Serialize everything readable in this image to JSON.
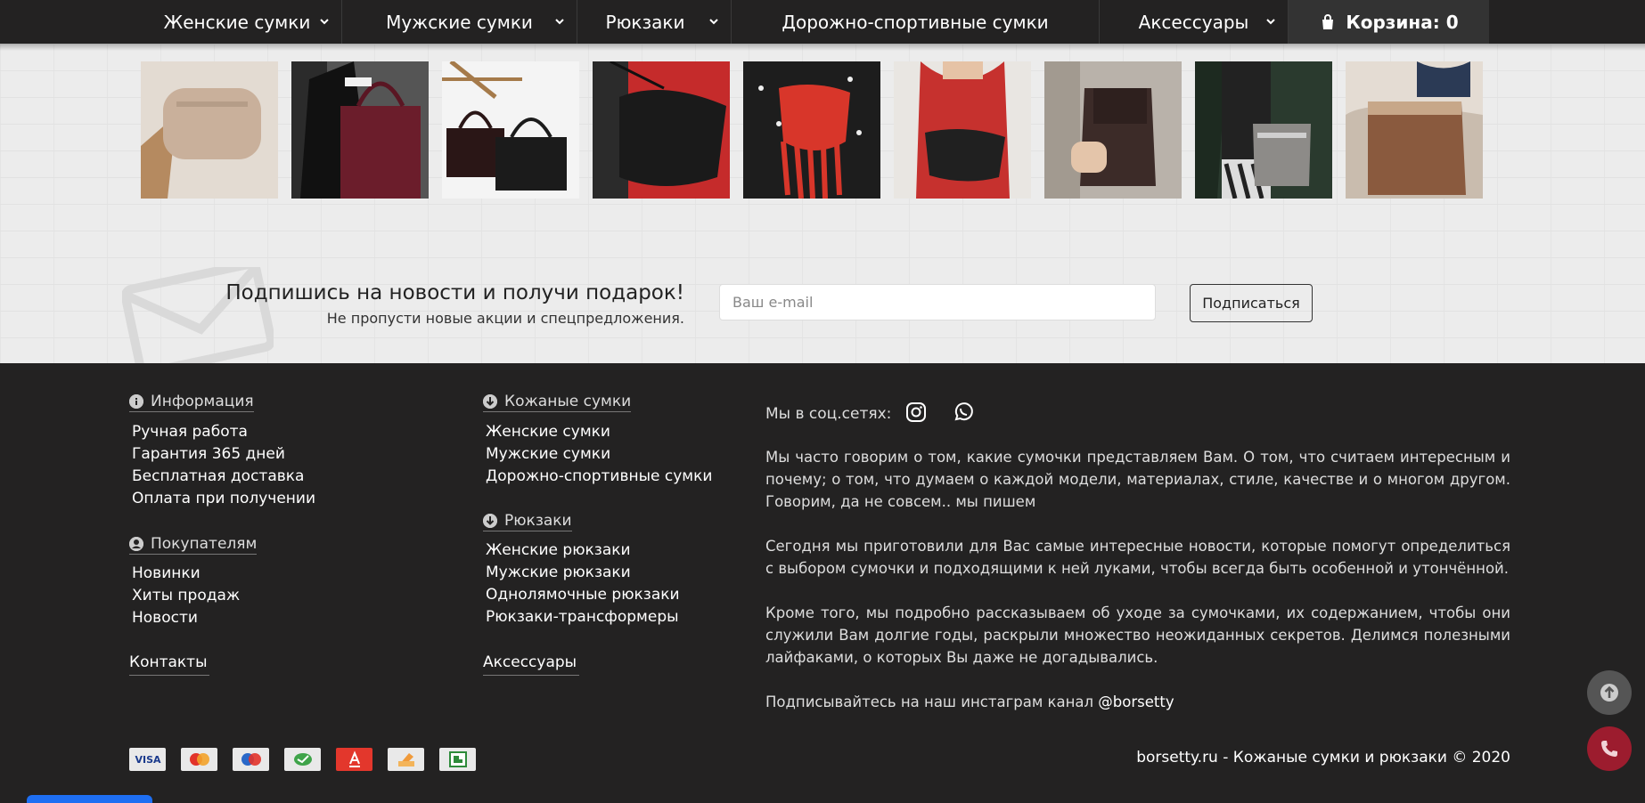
{
  "nav": {
    "items": [
      {
        "label": "Женские сумки",
        "width": 209,
        "dropdown": true
      },
      {
        "label": "Мужские сумки",
        "width": 264,
        "dropdown": true
      },
      {
        "label": "Рюкзаки",
        "width": 173,
        "dropdown": true
      },
      {
        "label": "Дорожно-спортивные сумки",
        "width": 413,
        "dropdown": false
      },
      {
        "label": "Аксессуары",
        "width": 212,
        "dropdown": true
      }
    ],
    "cart_label": "Корзина: 0"
  },
  "thumbs": [
    {
      "bg": "#e9e1da",
      "shape": "#c9b09b",
      "kind": "belt-bag"
    },
    {
      "bg": "#4b4b4b",
      "shape": "#6b1d2b",
      "kind": "tote-red"
    },
    {
      "bg": "#f4f4f4",
      "shape": "#1c1c1c",
      "kind": "two-bags"
    },
    {
      "bg": "#c52b2b",
      "shape": "#1a1a1a",
      "kind": "black-bag-red"
    },
    {
      "bg": "#222",
      "shape": "#d8362a",
      "kind": "fringe-bag"
    },
    {
      "bg": "#b82a2a",
      "shape": "#202020",
      "kind": "black-bag-red2"
    },
    {
      "bg": "#bdb5ad",
      "shape": "#3c2b28",
      "kind": "backpack-brown"
    },
    {
      "bg": "#2a3a2e",
      "shape": "#8d8b88",
      "kind": "grey-bag"
    },
    {
      "bg": "#d3c9bf",
      "shape": "#8a5a3e",
      "kind": "backpack-cognac"
    }
  ],
  "subscribe": {
    "title": "Подпишись на новости и получи подарок!",
    "text": "Не пропусти новые акции и спецпредложения.",
    "placeholder": "Ваш e-mail",
    "button": "Подписаться"
  },
  "footer": {
    "info_head": "Информация",
    "info_links": [
      "Ручная работа",
      "Гарантия 365 дней",
      "Бесплатная доставка",
      "Оплата при получении"
    ],
    "buyers_head": "Покупателям",
    "buyers_links": [
      "Новинки",
      "Хиты продаж",
      "Новости"
    ],
    "contacts": "Контакты",
    "leather_head": "Кожаные сумки",
    "leather_links": [
      "Женские сумки",
      "Мужские сумки",
      "Дорожно-спортивные сумки"
    ],
    "backpacks_head": "Рюкзаки",
    "backpacks_links": [
      "Женские рюкзаки",
      "Мужские рюкзаки",
      "Одноля­мочные рюкзаки",
      "Рюкзаки-трансформеры"
    ],
    "accessories": "Аксессуары",
    "social_label": "Мы в соц.сетях:",
    "para1": "Мы часто говорим о том, какие сумочки представляем Вам. О том, что считаем интересным и почему; о том, что думаем о каждой модели, материалах, стиле, качестве и о многом другом. Говорим, да не совсем.. мы пишем",
    "para2": "Сегодня мы приготовили для Вас самые интересные новости, которые помогут определиться с выбором сумочки и подходящими к ней луками, чтобы всегда быть особенной и утончённой.",
    "para3": "Кроме того, мы подробно рассказываем об уходе за сумочками, их содержанием, чтобы они служили Вам долгие годы, раскрыли множество неожиданных секретов. Делимся полезными лайфаками, о которых Вы даже не догадывались.",
    "para4_prefix": "Подписывайтесь на наш инстаграм канал ",
    "para4_link": "@borsetty",
    "copyright": "borsetty.ru - Кожаные сумки и рюкзаки © 2020",
    "payments": [
      "visa",
      "mastercard",
      "maestro",
      "sberbank",
      "alfa-bank",
      "qiwi",
      "other-bank"
    ]
  },
  "colors": {
    "dark": "#232222",
    "accent_call": "#9c1c2e",
    "scroll_up": "#555555"
  }
}
